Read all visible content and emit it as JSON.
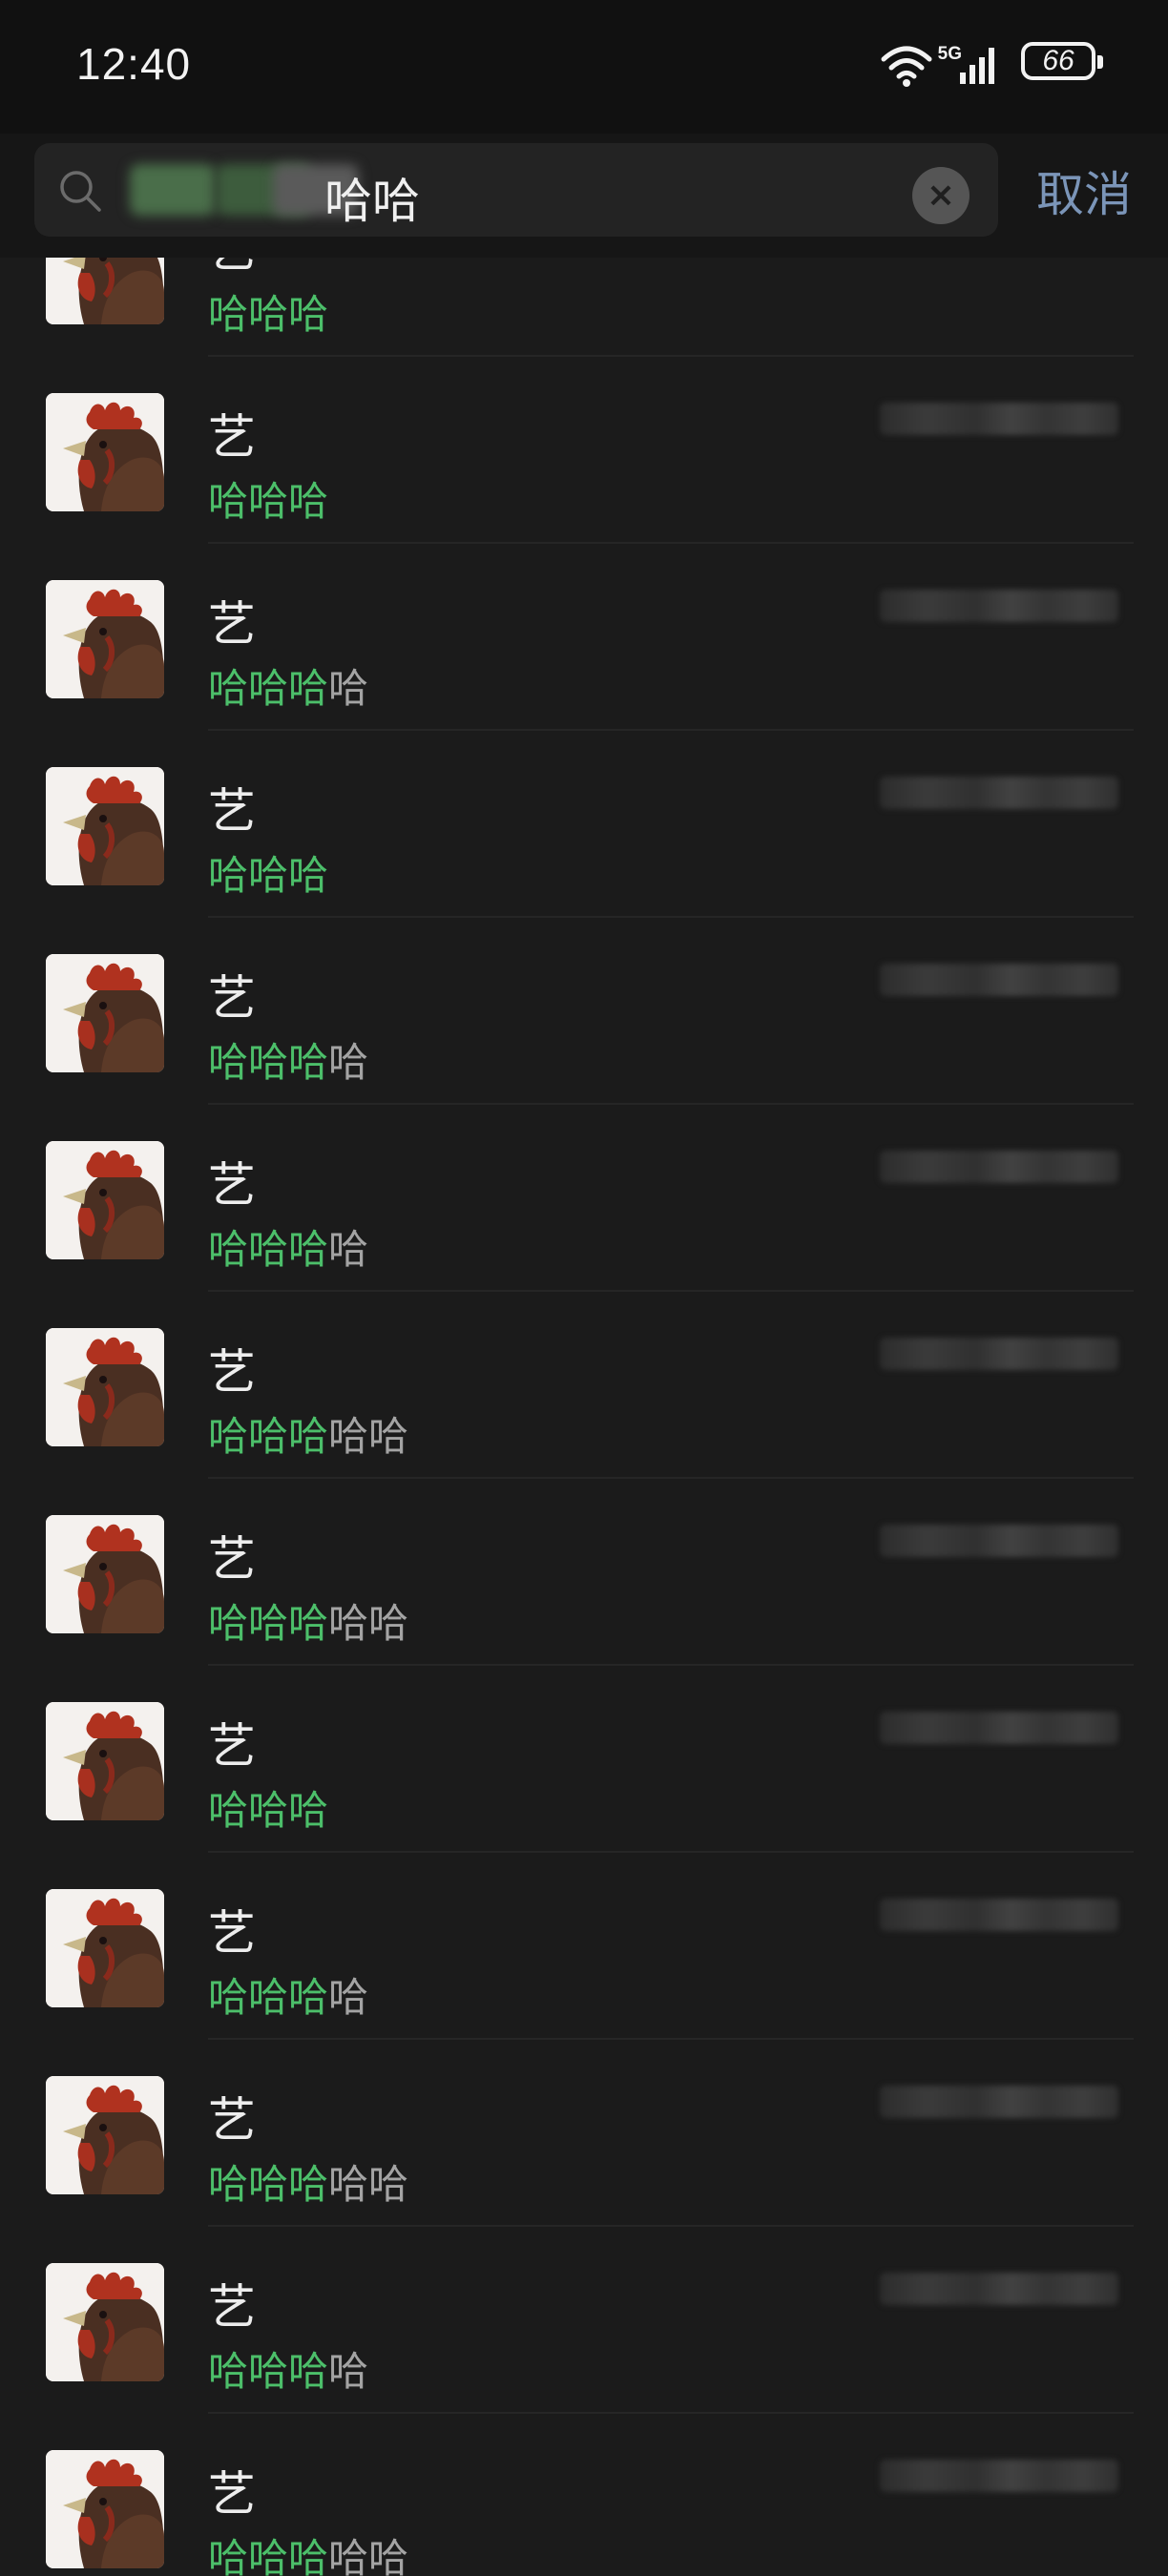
{
  "status_bar": {
    "time": "12:40",
    "network": "5G",
    "battery": "66"
  },
  "search": {
    "query_visible": "哈哈",
    "cancel_label": "取消",
    "clear_icon": "×"
  },
  "colors": {
    "background": "#1b1b1b",
    "highlight": "#4cbf6a",
    "link": "#7b95b8"
  },
  "results": [
    {
      "name": "艺",
      "highlight": "哈哈哈",
      "rest": ""
    },
    {
      "name": "艺",
      "highlight": "哈哈哈",
      "rest": ""
    },
    {
      "name": "艺",
      "highlight": "哈哈哈",
      "rest": "哈"
    },
    {
      "name": "艺",
      "highlight": "哈哈哈",
      "rest": ""
    },
    {
      "name": "艺",
      "highlight": "哈哈哈",
      "rest": "哈"
    },
    {
      "name": "艺",
      "highlight": "哈哈哈",
      "rest": "哈"
    },
    {
      "name": "艺",
      "highlight": "哈哈哈",
      "rest": "哈哈"
    },
    {
      "name": "艺",
      "highlight": "哈哈哈",
      "rest": "哈哈"
    },
    {
      "name": "艺",
      "highlight": "哈哈哈",
      "rest": ""
    },
    {
      "name": "艺",
      "highlight": "哈哈哈",
      "rest": "哈"
    },
    {
      "name": "艺",
      "highlight": "哈哈哈",
      "rest": "哈哈"
    },
    {
      "name": "艺",
      "highlight": "哈哈哈",
      "rest": "哈"
    },
    {
      "name": "艺",
      "highlight": "哈哈哈",
      "rest": "哈哈"
    }
  ]
}
